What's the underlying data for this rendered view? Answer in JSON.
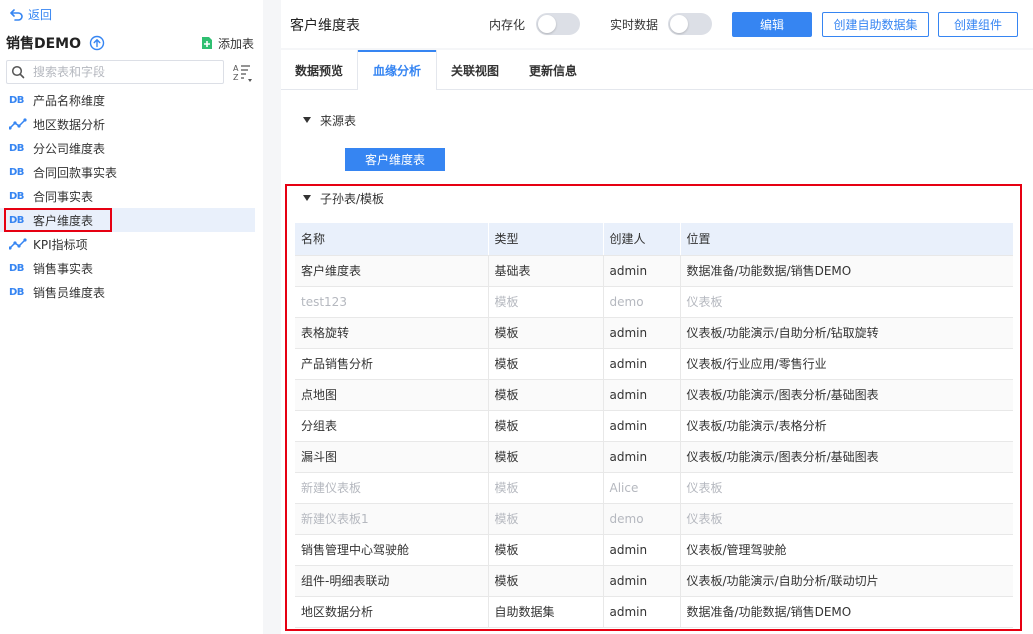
{
  "sidebar": {
    "back_label": "返回",
    "package_title": "销售DEMO",
    "add_table_label": "添加表",
    "search_placeholder": "搜索表和字段",
    "items": [
      {
        "icon": "db-icon",
        "label": "产品名称维度"
      },
      {
        "icon": "line-chart-icon",
        "label": "地区数据分析"
      },
      {
        "icon": "db-icon",
        "label": "分公司维度表"
      },
      {
        "icon": "db-icon",
        "label": "合同回款事实表"
      },
      {
        "icon": "db-icon",
        "label": "合同事实表"
      },
      {
        "icon": "db-icon",
        "label": "客户维度表",
        "active": true
      },
      {
        "icon": "line-chart-icon",
        "label": "KPI指标项"
      },
      {
        "icon": "db-icon",
        "label": "销售事实表"
      },
      {
        "icon": "db-icon",
        "label": "销售员维度表"
      }
    ],
    "db_icon_text": "DB"
  },
  "header": {
    "title": "客户维度表",
    "toggle1_label": "内存化",
    "toggle2_label": "实时数据",
    "edit_label": "编辑",
    "create_dataset_label": "创建自助数据集",
    "create_component_label": "创建组件"
  },
  "tabs": [
    "数据预览",
    "血缘分析",
    "关联视图",
    "更新信息"
  ],
  "active_tab": "血缘分析",
  "lineage": {
    "source_section": "来源表",
    "source_table": "客户维度表",
    "child_section": "子孙表/模板",
    "columns": [
      "名称",
      "类型",
      "创建人",
      "位置"
    ],
    "rows": [
      {
        "name": "客户维度表",
        "type": "基础表",
        "creator": "admin",
        "location": "数据准备/功能数据/销售DEMO",
        "dim": false
      },
      {
        "name": "test123",
        "type": "模板",
        "creator": "demo",
        "location": "仪表板",
        "dim": true
      },
      {
        "name": "表格旋转",
        "type": "模板",
        "creator": "admin",
        "location": "仪表板/功能演示/自助分析/钻取旋转",
        "dim": false
      },
      {
        "name": "产品销售分析",
        "type": "模板",
        "creator": "admin",
        "location": "仪表板/行业应用/零售行业",
        "dim": false
      },
      {
        "name": "点地图",
        "type": "模板",
        "creator": "admin",
        "location": "仪表板/功能演示/图表分析/基础图表",
        "dim": false
      },
      {
        "name": "分组表",
        "type": "模板",
        "creator": "admin",
        "location": "仪表板/功能演示/表格分析",
        "dim": false
      },
      {
        "name": "漏斗图",
        "type": "模板",
        "creator": "admin",
        "location": "仪表板/功能演示/图表分析/基础图表",
        "dim": false
      },
      {
        "name": "新建仪表板",
        "type": "模板",
        "creator": "Alice",
        "location": "仪表板",
        "dim": true
      },
      {
        "name": "新建仪表板1",
        "type": "模板",
        "creator": "demo",
        "location": "仪表板",
        "dim": true
      },
      {
        "name": "销售管理中心驾驶舱",
        "type": "模板",
        "creator": "admin",
        "location": "仪表板/管理驾驶舱",
        "dim": false
      },
      {
        "name": "组件-明细表联动",
        "type": "模板",
        "creator": "admin",
        "location": "仪表板/功能演示/自助分析/联动切片",
        "dim": false
      },
      {
        "name": "地区数据分析",
        "type": "自助数据集",
        "creator": "admin",
        "location": "数据准备/功能数据/销售DEMO",
        "dim": false
      }
    ]
  },
  "colors": {
    "accent": "#3685f2",
    "highlight": "#e60012",
    "row_hover": "#e9f0fb",
    "dim_text": "#b5b8bf"
  }
}
